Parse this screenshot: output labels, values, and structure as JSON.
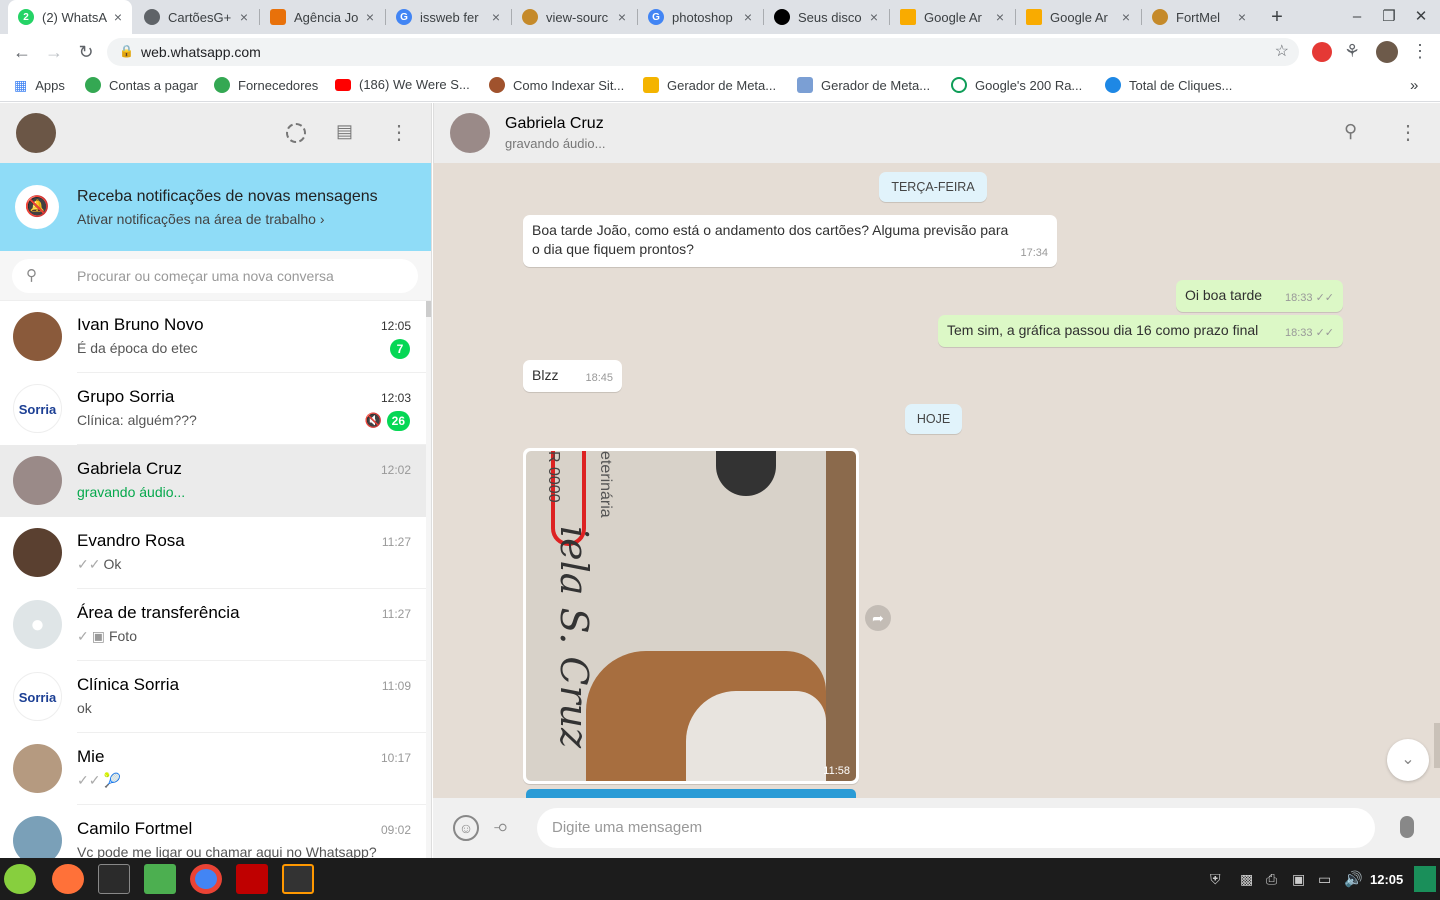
{
  "browser": {
    "tabs": [
      {
        "label": "(2) WhatsA",
        "badge": "2",
        "fav_color": "#25d366",
        "active": true
      },
      {
        "label": "CartõesG+",
        "fav_color": "#5f6368"
      },
      {
        "label": "Agência Jo",
        "fav_color": "#e8710a"
      },
      {
        "label": "issweb fer",
        "fav_color": "#4285f4"
      },
      {
        "label": "view-sourc",
        "fav_color": "#c58a2a"
      },
      {
        "label": "photoshop",
        "fav_color": "#4285f4"
      },
      {
        "label": "Seus disco",
        "fav_color": "#000000"
      },
      {
        "label": "Google Ar",
        "fav_color": "#f9ab00"
      },
      {
        "label": "Google Ar",
        "fav_color": "#f9ab00"
      },
      {
        "label": "FortMel",
        "fav_color": "#c58a2a"
      }
    ],
    "new_tab": "+",
    "close_glyph": "×",
    "url": "web.whatsapp.com",
    "bookmarks": [
      {
        "label": "Apps",
        "color": "#4285f4"
      },
      {
        "label": "Contas a pagar",
        "color": "#34a853"
      },
      {
        "label": "Fornecedores",
        "color": "#34a853"
      },
      {
        "label": "(186) We Were S...",
        "color": "#ff0000"
      },
      {
        "label": "Como Indexar Sit...",
        "color": "#a0522d"
      },
      {
        "label": "Gerador de Meta...",
        "color": "#f4b400"
      },
      {
        "label": "Gerador de Meta...",
        "color": "#7b9fd4"
      },
      {
        "label": "Google's 200 Ra...",
        "color": "#0f9d58"
      },
      {
        "label": "Total de Cliques...",
        "color": "#1e88e5"
      }
    ],
    "bookmarks_more": "»"
  },
  "notification": {
    "title": "Receba notificações de novas mensagens",
    "link": "Ativar notificações na área de trabalho ›"
  },
  "search": {
    "placeholder": "Procurar ou começar uma nova conversa"
  },
  "chats": [
    {
      "name": "Ivan Bruno Novo",
      "time": "12:05",
      "preview": "É da época do etec",
      "badge": "7",
      "avatar_color": "#8a5a3b"
    },
    {
      "name": "Grupo Sorria",
      "time": "12:03",
      "preview": "Clínica: alguém???",
      "badge": "26",
      "muted": true,
      "avatar_color": "#ffffff",
      "logo": "Sorria"
    },
    {
      "name": "Gabriela Cruz",
      "time": "12:02",
      "preview": "gravando áudio...",
      "avatar_color": "#9a8a88"
    },
    {
      "name": "Evandro Rosa",
      "time": "11:27",
      "preview": "Ok",
      "ticks": "✓✓",
      "avatar_color": "#5a4030"
    },
    {
      "name": "Área de transferência",
      "time": "11:27",
      "preview": "Foto",
      "ticks": "✓",
      "avatar_color": "#dfe5e7"
    },
    {
      "name": "Clínica Sorria",
      "time": "11:09",
      "preview": "ok",
      "avatar_color": "#ffffff",
      "logo": "Sorria"
    },
    {
      "name": "Mie",
      "time": "10:17",
      "preview": "🎾",
      "ticks": "✓✓",
      "avatar_color": "#b59a80"
    },
    {
      "name": "Camilo Fortmel",
      "time": "09:02",
      "preview": "Vc pode me ligar ou chamar aqui no Whatsapp?",
      "avatar_color": "#7aa0b8"
    }
  ],
  "conversation": {
    "name": "Gabriela Cruz",
    "status": "gravando áudio...",
    "day1": "TERÇA-FEIRA",
    "day2": "HOJE",
    "messages": [
      {
        "dir": "in",
        "text": "Boa tarde João, como está o andamento dos cartões? Alguma previsão para o dia que fiquem prontos?",
        "time": "17:34"
      },
      {
        "dir": "out",
        "text": "Oi boa tarde",
        "time": "18:33",
        "ticks": "✓✓"
      },
      {
        "dir": "out",
        "text": "Tem sim, a gráfica passou dia 16 como prazo final",
        "time": "18:33",
        "ticks": "✓✓"
      },
      {
        "dir": "in",
        "text": "Blzz",
        "time": "18:45"
      }
    ],
    "image_time": "11:58",
    "image_text": "iela S. Cruz",
    "image_subtext": "eterinária",
    "image_phone": "R 0000",
    "composer_placeholder": "Digite uma mensagem"
  },
  "taskbar": {
    "clock": "12:05",
    "apps": [
      {
        "name": "mint",
        "color": "#87cf3e"
      },
      {
        "name": "firefox",
        "color": "#ff7139"
      },
      {
        "name": "terminal",
        "color": "#2b2b2b"
      },
      {
        "name": "files",
        "color": "#4caf50"
      },
      {
        "name": "chrome",
        "color": "#4285f4"
      },
      {
        "name": "filezilla",
        "color": "#bf0000"
      },
      {
        "name": "sublime",
        "color": "#ff9800"
      }
    ]
  }
}
